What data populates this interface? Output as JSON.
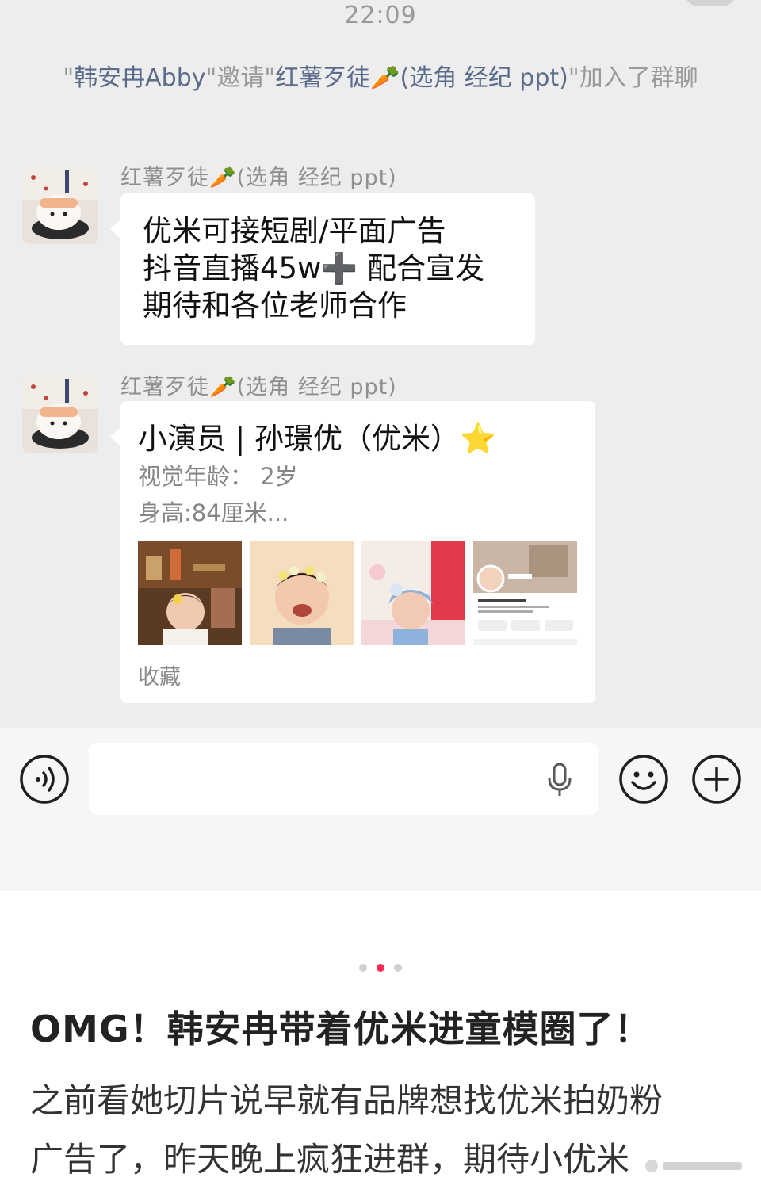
{
  "chat": {
    "time": "22:09",
    "system_message": {
      "q1": "\"",
      "inviter": "韩安冉Abby",
      "q2": "\"邀请\"",
      "invitee": "红薯歹徒🥕(选角 经纪 ppt)",
      "q3": "\"加入了群聊"
    },
    "messages": [
      {
        "sender": "红薯歹徒🥕(选角 经纪 ppt)",
        "lines": [
          "优米可接短剧/平面广告",
          "抖音直播45w➕ 配合宣发",
          "期待和各位老师合作"
        ]
      },
      {
        "sender": "红薯歹徒🥕(选角 经纪 ppt)",
        "card": {
          "title": "小演员 | 孙璟优（优米）⭐",
          "line1": "视觉年龄： 2岁",
          "line2": "身高:84厘米...",
          "footer": "收藏"
        }
      }
    ]
  },
  "input_bar": {
    "icons": [
      "voice-icon",
      "microphone-icon",
      "emoji-icon",
      "plus-icon"
    ]
  },
  "carousel": {
    "count": 3,
    "active": 2
  },
  "post": {
    "title": "OMG！韩安冉带着优米进童模圈了！",
    "body_lines": [
      "之前看她切片说早就有品牌想找优米拍奶粉",
      "广告了，昨天晚上疯狂进群，期待小优米"
    ]
  },
  "colors": {
    "chat_bg": "#ededed",
    "bubble": "#ffffff",
    "accent_dot": "#fe2c55",
    "system_name": "#5a6b8c"
  }
}
